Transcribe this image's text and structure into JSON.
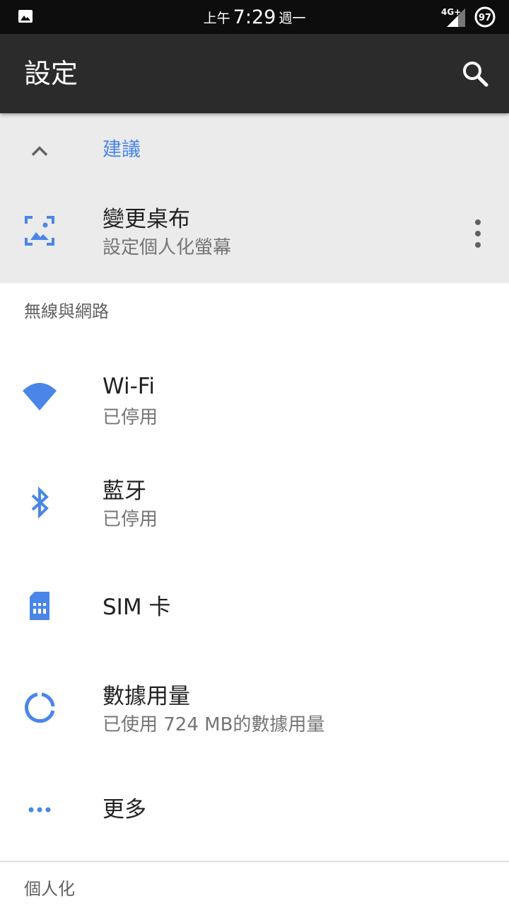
{
  "status_bar": {
    "am_pm": "上午",
    "time": "7:29",
    "weekday": "週一",
    "network_label": "4G+",
    "battery_level": "97"
  },
  "app_bar": {
    "title": "設定"
  },
  "suggestions": {
    "header_label": "建議",
    "items": [
      {
        "title": "變更桌布",
        "subtitle": "設定個人化螢幕"
      }
    ]
  },
  "sections": [
    {
      "header": "無線與網路",
      "items": [
        {
          "title": "Wi-Fi",
          "subtitle": "已停用"
        },
        {
          "title": "藍牙",
          "subtitle": "已停用"
        },
        {
          "title": "SIM 卡",
          "subtitle": ""
        },
        {
          "title": "數據用量",
          "subtitle": "已使用 724 MB的數據用量"
        },
        {
          "title": "更多",
          "subtitle": ""
        }
      ]
    },
    {
      "header": "個人化",
      "items": []
    }
  ],
  "colors": {
    "accent": "#4a86e8",
    "status_bar": "#0d0d0d",
    "app_bar": "#2b2b2b",
    "suggestion_bg": "#ebebeb"
  },
  "icons": {
    "status_left": "image-icon",
    "search": "search-icon",
    "collapse": "chevron-up-icon",
    "wallpaper": "wallpaper-icon",
    "overflow": "more-vert-icon",
    "wifi": "wifi-icon",
    "bluetooth": "bluetooth-icon",
    "sim": "sim-card-icon",
    "data_usage": "data-usage-icon",
    "more": "more-horiz-icon"
  }
}
